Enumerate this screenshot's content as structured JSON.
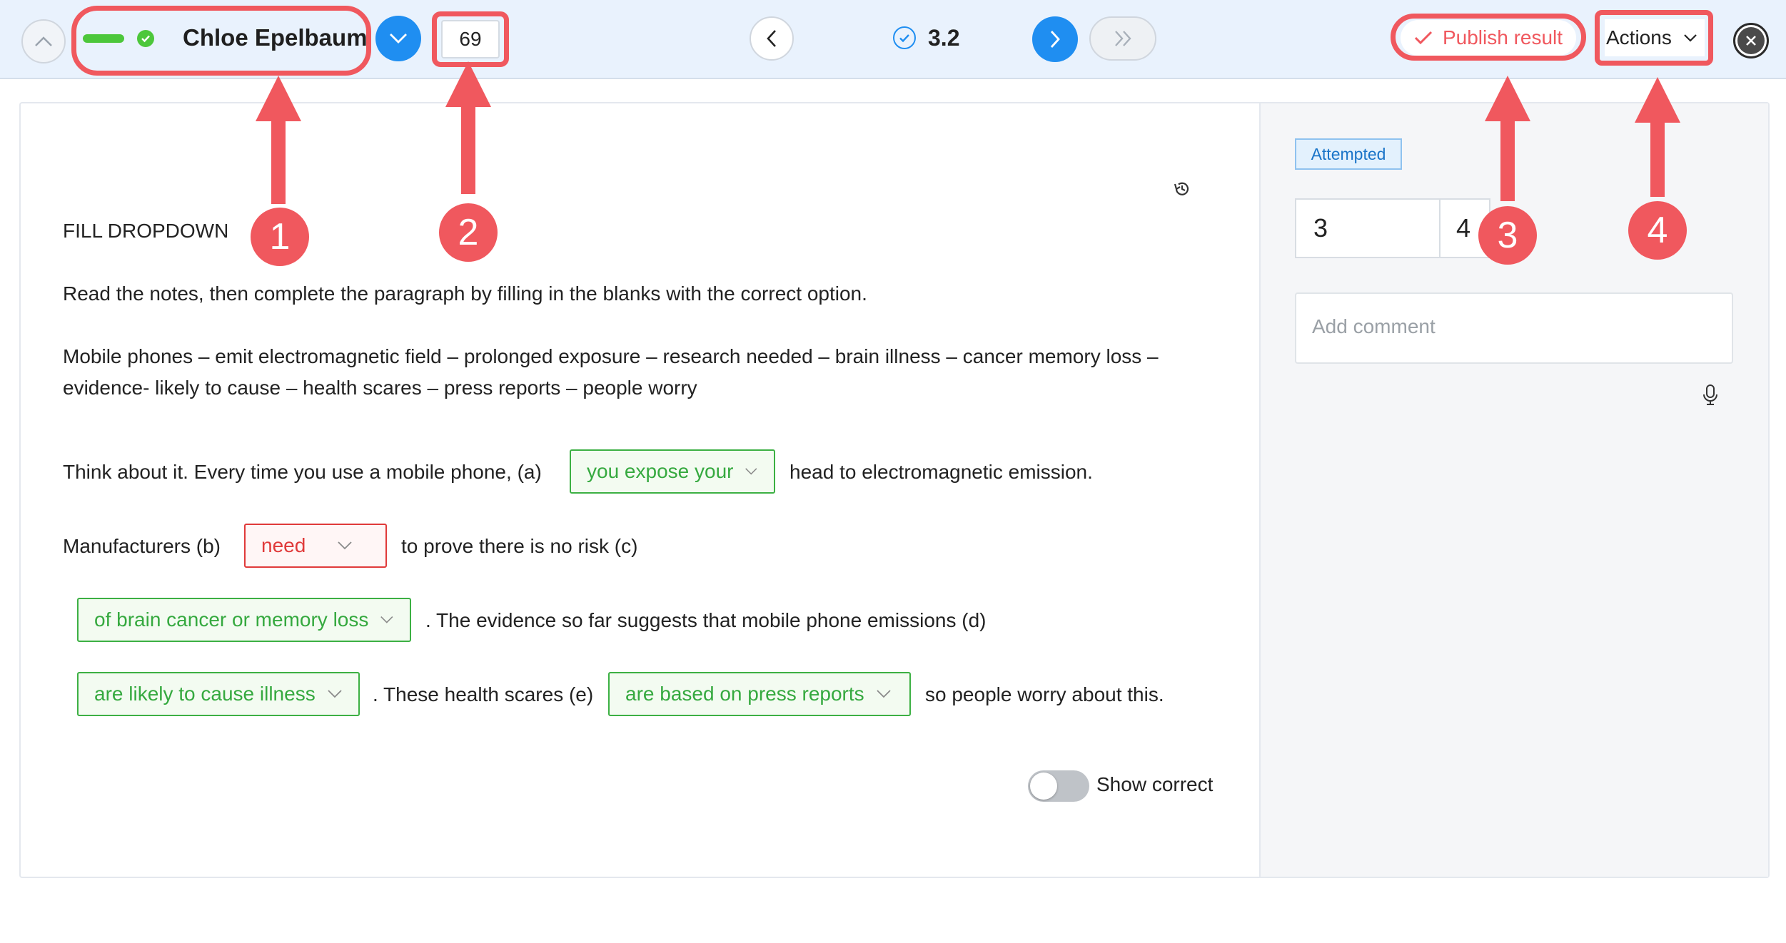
{
  "header": {
    "student_name": "Chloe Epelbaum",
    "score_input_value": "69",
    "question_number": "3.2",
    "publish_label": "Publish result",
    "actions_label": "Actions"
  },
  "question": {
    "type_label": "FILL DROPDOWN",
    "instruction": "Read the notes, then complete the paragraph by filling in the blanks with the correct option.",
    "notes_line1": "Mobile phones – emit electromagnetic field – prolonged exposure – research needed – brain illness – cancer memory loss –",
    "notes_line2": "evidence- likely to cause – health scares – press reports – people worry",
    "s1_pre": "Think about it. Every time you use a mobile phone, (a)",
    "dd_a": "you expose your",
    "s1_post": "head to electromagnetic emission.",
    "s2_pre": "Manufacturers (b)",
    "dd_b": "need",
    "s2_post": "to prove there is no risk (c)",
    "dd_c": "of brain cancer or memory loss",
    "s3_post": ". The evidence so far suggests that mobile phone emissions (d)",
    "dd_d": "are likely to cause illness",
    "s4_mid": ". These health scares (e)",
    "dd_e": "are based on press reports",
    "s4_post": "so people worry about this.",
    "show_correct_label": "Show correct"
  },
  "sidebar": {
    "status_badge": "Attempted",
    "score_value": "3",
    "score_max": "4",
    "comment_placeholder": "Add comment"
  },
  "callouts": [
    "1",
    "2",
    "3",
    "4"
  ],
  "colors": {
    "accent_blue": "#1f8ef1",
    "callout_red": "#f0585e",
    "correct_green": "#35a93f",
    "wrong_red": "#e03a3a"
  }
}
